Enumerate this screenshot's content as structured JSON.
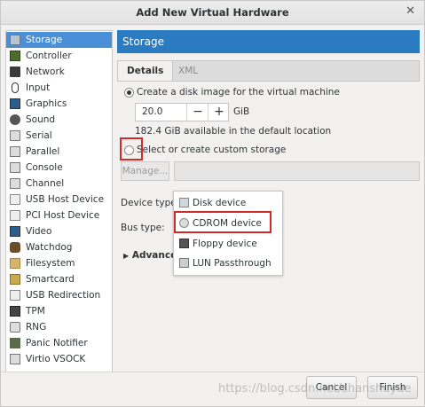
{
  "window": {
    "title": "Add New Virtual Hardware",
    "close_label": "✕"
  },
  "sidebar": {
    "items": [
      {
        "label": "Storage",
        "icon": "storage-icon",
        "selected": true
      },
      {
        "label": "Controller",
        "icon": "controller-icon"
      },
      {
        "label": "Network",
        "icon": "network-icon"
      },
      {
        "label": "Input",
        "icon": "mouse-icon"
      },
      {
        "label": "Graphics",
        "icon": "graphics-icon"
      },
      {
        "label": "Sound",
        "icon": "sound-icon"
      },
      {
        "label": "Serial",
        "icon": "serial-icon"
      },
      {
        "label": "Parallel",
        "icon": "parallel-icon"
      },
      {
        "label": "Console",
        "icon": "console-icon"
      },
      {
        "label": "Channel",
        "icon": "channel-icon"
      },
      {
        "label": "USB Host Device",
        "icon": "usb-icon"
      },
      {
        "label": "PCI Host Device",
        "icon": "pci-icon"
      },
      {
        "label": "Video",
        "icon": "video-icon"
      },
      {
        "label": "Watchdog",
        "icon": "watchdog-icon"
      },
      {
        "label": "Filesystem",
        "icon": "folder-icon"
      },
      {
        "label": "Smartcard",
        "icon": "smartcard-icon"
      },
      {
        "label": "USB Redirection",
        "icon": "usb-redirection-icon"
      },
      {
        "label": "TPM",
        "icon": "tpm-icon"
      },
      {
        "label": "RNG",
        "icon": "rng-icon"
      },
      {
        "label": "Panic Notifier",
        "icon": "panic-icon"
      },
      {
        "label": "Virtio VSOCK",
        "icon": "vsock-icon"
      }
    ]
  },
  "main": {
    "header": "Storage",
    "tabs": [
      {
        "label": "Details"
      },
      {
        "label": "XML"
      }
    ],
    "create_disk_label": "Create a disk image for the virtual machine",
    "disk_size_value": "20.0",
    "disk_size_unit": "GiB",
    "minus_label": "−",
    "plus_label": "+",
    "available_text": "182.4 GiB available in the default location",
    "custom_storage_label": "Select or create custom storage",
    "manage_label": "Manage...",
    "device_type_label": "Device type:",
    "bus_type_label": "Bus type:",
    "advanced_label": "Advanced"
  },
  "device_dropdown": {
    "items": [
      {
        "label": "Disk device",
        "icon": "disk-device-icon"
      },
      {
        "label": "CDROM device",
        "icon": "cdrom-icon",
        "highlighted": true
      },
      {
        "label": "Floppy device",
        "icon": "floppy-icon"
      },
      {
        "label": "LUN Passthrough",
        "icon": "lun-icon"
      }
    ]
  },
  "buttons": {
    "cancel": "Cancel",
    "finish": "Finish"
  },
  "watermark": "https://blog.csdn.net/shanshuyue",
  "colors": {
    "accent": "#2a7bbf",
    "selection": "#4a90d9",
    "highlight_box": "#d12a2a"
  }
}
